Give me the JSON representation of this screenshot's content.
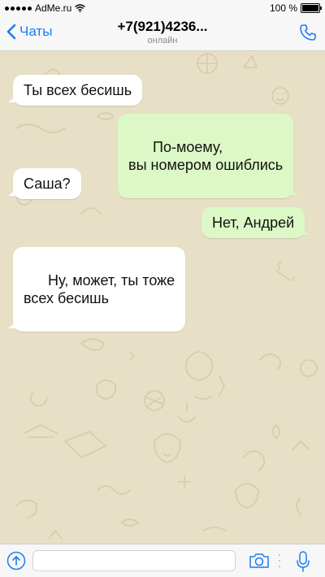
{
  "status_bar": {
    "carrier": "AdMe.ru",
    "time": "",
    "battery": "100 %"
  },
  "nav": {
    "back_label": "Чаты",
    "title": "+7(921)4236...",
    "subtitle": "онлайн"
  },
  "messages": [
    {
      "direction": "in",
      "text": "Ты всех бесишь"
    },
    {
      "direction": "out",
      "text": "По-моему,\nвы номером ошиблись"
    },
    {
      "direction": "in",
      "text": "Саша?"
    },
    {
      "direction": "out",
      "text": "Нет, Андрей"
    },
    {
      "direction": "in",
      "text": "Ну, может, ты тоже\nвсех бесишь"
    }
  ],
  "input": {
    "value": "",
    "placeholder": ""
  },
  "icons": {
    "back": "chevron-left-icon",
    "call": "phone-icon",
    "upload": "upload-icon",
    "camera": "camera-icon",
    "mic": "microphone-icon"
  },
  "colors": {
    "accent": "#1a7cf6",
    "incoming_bubble": "#ffffff",
    "outgoing_bubble": "#dcf8c6",
    "chat_background": "#e7dfc6"
  }
}
